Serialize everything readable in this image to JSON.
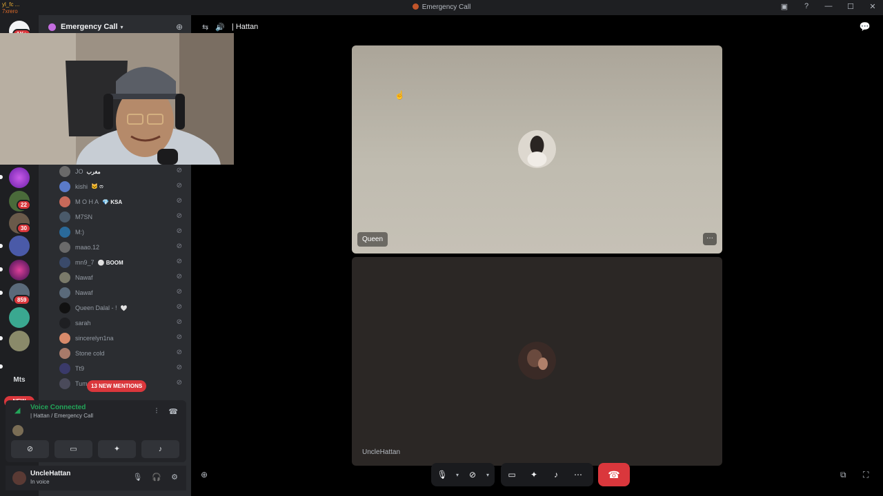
{
  "window": {
    "title": "Emergency Call",
    "overlay_chat": [
      "yl_fc ...",
      "7xrero"
    ]
  },
  "guilds": {
    "badges": [
      "1K+",
      "22",
      "30",
      "859"
    ],
    "text_guild": "Mts",
    "new_label": "NEW"
  },
  "server": {
    "name": "Emergency Call"
  },
  "members": [
    {
      "name": "JO",
      "tag": "مغرب"
    },
    {
      "name": "kishi",
      "tag": "🐱 ෆ"
    },
    {
      "name": "M O H A",
      "tag": "💎 KSA"
    },
    {
      "name": "M7SN",
      "tag": ""
    },
    {
      "name": "M:)",
      "tag": ""
    },
    {
      "name": "maao.12",
      "tag": ""
    },
    {
      "name": "mn9_7",
      "tag": "⚪ BOOM"
    },
    {
      "name": "Nawaf",
      "tag": ""
    },
    {
      "name": "Nawaf",
      "tag": ""
    },
    {
      "name": "Queen Dalal - !",
      "tag": "🤍"
    },
    {
      "name": "sarah",
      "tag": ""
    },
    {
      "name": "sincerelyn1na",
      "tag": ""
    },
    {
      "name": "Stone cold",
      "tag": ""
    },
    {
      "name": "Tt9",
      "tag": ""
    },
    {
      "name": "Tum",
      "tag": ""
    }
  ],
  "mentions_pill": "13 NEW MENTIONS",
  "voice": {
    "status": "Voice Connected",
    "channel": "| Hattan / Emergency Call"
  },
  "user": {
    "name": "UncleHattan",
    "status": "In voice"
  },
  "stage": {
    "channel_name": "| Hattan",
    "tiles": [
      {
        "name": "Queen"
      },
      {
        "name": "UncleHattan"
      }
    ],
    "more_label": "···"
  },
  "icons": {
    "titlebar": [
      "inbox-icon",
      "help-icon",
      "minimize-icon",
      "maximize-icon",
      "close-icon"
    ],
    "controls": [
      "microphone-icon",
      "camera-off-icon",
      "screen-share-icon",
      "activities-icon",
      "soundboard-icon",
      "more-icon",
      "disconnect-icon"
    ]
  }
}
